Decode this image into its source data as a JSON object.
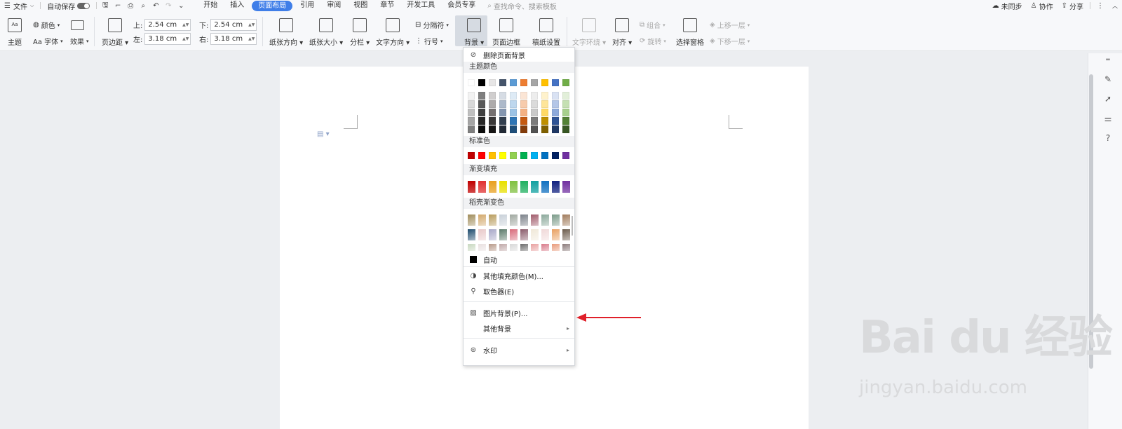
{
  "topbar": {
    "file_menu": "文件",
    "autosave": "自动保存",
    "tabs": [
      "开始",
      "插入",
      "页面布局",
      "引用",
      "审阅",
      "视图",
      "章节",
      "开发工具",
      "会员专享"
    ],
    "active_tab": "页面布局",
    "search_placeholder": "查找命令、搜索模板",
    "sync": "未同步",
    "collab": "协作",
    "share": "分享"
  },
  "ribbon": {
    "theme": "主题",
    "color": "颜色",
    "font": "Aa 字体",
    "effect": "效果",
    "margins": "页边距",
    "top_label": "上:",
    "top_value": "2.54 cm",
    "bottom_label": "下:",
    "bottom_value": "2.54 cm",
    "left_label": "左:",
    "left_value": "3.18 cm",
    "right_label": "右:",
    "right_value": "3.18 cm",
    "orientation": "纸张方向",
    "size": "纸张大小",
    "columns": "分栏",
    "text_direction": "文字方向",
    "separator": "分隔符",
    "line_number": "行号",
    "background": "背景",
    "page_border": "页面边框",
    "manuscript": "稿纸设置",
    "text_wrap": "文字环绕",
    "align": "对齐",
    "group": "组合",
    "rotate": "旋转",
    "selection_pane": "选择窗格",
    "bring_forward": "上移一层",
    "send_backward": "下移一层"
  },
  "menu": {
    "remove_bg": "删除页面背景",
    "theme_colors": "主题颜色",
    "standard_colors": "标准色",
    "gradient_fill": "渐变填充",
    "preset_gradient": "稻壳渐变色",
    "auto": "自动",
    "more_fill": "其他填充颜色(M)...",
    "eyedropper": "取色器(E)",
    "picture_bg": "图片背景(P)...",
    "other_bg": "其他背景",
    "watermark": "水印"
  },
  "colors": {
    "theme_top": [
      "#ffffff",
      "#000000",
      "#e7e6e6",
      "#44546a",
      "#5b9bd5",
      "#ed7d31",
      "#a5a5a5",
      "#ffc000",
      "#4472c4",
      "#70ad47"
    ],
    "theme_shades": [
      [
        "#f2f2f2",
        "#7f7f7f",
        "#d0cece",
        "#d6dce4",
        "#deebf6",
        "#fbe5d5",
        "#ededed",
        "#fff2cc",
        "#d9e2f3",
        "#e2efd9"
      ],
      [
        "#d8d8d8",
        "#595959",
        "#aeabab",
        "#adb9ca",
        "#bdd7ee",
        "#f7cbac",
        "#dbdbdb",
        "#fee599",
        "#b4c6e7",
        "#c5e0b3"
      ],
      [
        "#bfbfbf",
        "#3f3f3f",
        "#757070",
        "#8496b0",
        "#9cc3e5",
        "#f4b183",
        "#c9c9c9",
        "#ffd965",
        "#8eaadb",
        "#a8d08d"
      ],
      [
        "#a5a5a5",
        "#262626",
        "#3a3838",
        "#323f4f",
        "#2e75b5",
        "#c55a11",
        "#7b7b7b",
        "#bf9000",
        "#2f5496",
        "#538135"
      ],
      [
        "#7f7f7f",
        "#0c0c0c",
        "#171616",
        "#222a35",
        "#1e4e79",
        "#833c0b",
        "#525252",
        "#7f6000",
        "#1f3864",
        "#375623"
      ]
    ],
    "standard": [
      "#c00000",
      "#ff0000",
      "#ffc000",
      "#ffff00",
      "#92d050",
      "#00b050",
      "#00b0f0",
      "#0070c0",
      "#002060",
      "#7030a0"
    ],
    "gradient": [
      "#c00000",
      "#e03030",
      "#e8a020",
      "#e8e000",
      "#80c040",
      "#20b060",
      "#10a0a0",
      "#1070c0",
      "#102080",
      "#7030a0"
    ],
    "preset": [
      [
        "#a08c5a",
        "#d2a86a",
        "#b89c5c",
        "#c8d0d8",
        "#a0a8a0",
        "#7a8088",
        "#a05a6a",
        "#8aa89a",
        "#7a9a88",
        "#a07a5a"
      ],
      [
        "#1c4a6c",
        "#e8c8c8",
        "#a8a8c8",
        "#5a7a6a",
        "#d86a7a",
        "#8a5a6a",
        "#f0e8d8",
        "#f0d8d8",
        "#e8a060",
        "#6a5a4a"
      ],
      [
        "#c8d8c0",
        "#e8e0e0",
        "#b89a8a",
        "#c0a8a8",
        "#d8d8d8",
        "#6a6a6a",
        "#e8a0a0",
        "#d87a8a",
        "#e89a7a",
        "#8a7a7a"
      ]
    ],
    "accent": "#3f7ee8",
    "arrow": "#e0202a"
  },
  "watermark": {
    "big": "Bai du 经验",
    "small": "jingyan.baidu.com"
  }
}
